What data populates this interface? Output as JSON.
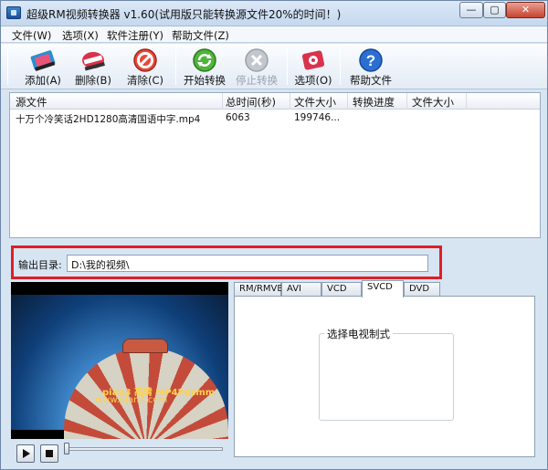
{
  "window": {
    "title": "超级RM视频转换器 v1.60(试用版只能转换源文件20%的时间！)",
    "min_glyph": "—",
    "max_glyph": "▢",
    "close_glyph": "✕"
  },
  "menu": [
    "文件(W)",
    "选项(X)",
    "软件注册(Y)",
    "帮助文件(Z)"
  ],
  "toolbar": [
    {
      "label": "添加(A)",
      "icon": "film-add-icon",
      "enabled": true
    },
    {
      "label": "删除(B)",
      "icon": "film-delete-icon",
      "enabled": true
    },
    {
      "label": "清除(C)",
      "icon": "clear-icon",
      "enabled": true
    },
    {
      "label": "开始转换",
      "icon": "start-convert-icon",
      "enabled": true
    },
    {
      "label": "停止转换",
      "icon": "stop-convert-icon",
      "enabled": false
    },
    {
      "label": "选项(O)",
      "icon": "options-icon",
      "enabled": true
    },
    {
      "label": "帮助文件",
      "icon": "help-icon",
      "enabled": true
    }
  ],
  "file_list": {
    "columns": [
      "源文件",
      "总时间(秒)",
      "文件大小",
      "转换进度",
      "文件大小"
    ],
    "rows": [
      {
        "source": "十万个冷笑话2HD1280高清国语中字.mp4",
        "duration": "6063",
        "size": "199746...",
        "progress": "",
        "out_size": ""
      }
    ]
  },
  "output": {
    "label": "输出目录:",
    "path": "D:\\我的视频\\"
  },
  "preview": {
    "watermark_line1": "pian3 高清 MP4Pasmm",
    "watermark_line2": "www.pian3.com"
  },
  "tabs": {
    "items": [
      "RM/RMVB",
      "AVI",
      "VCD",
      "SVCD",
      "DVD"
    ],
    "active": "SVCD",
    "group_title": "选择电视制式"
  },
  "colors": {
    "highlight_border": "#e01e25",
    "window_bg": "#d7e4f2"
  }
}
